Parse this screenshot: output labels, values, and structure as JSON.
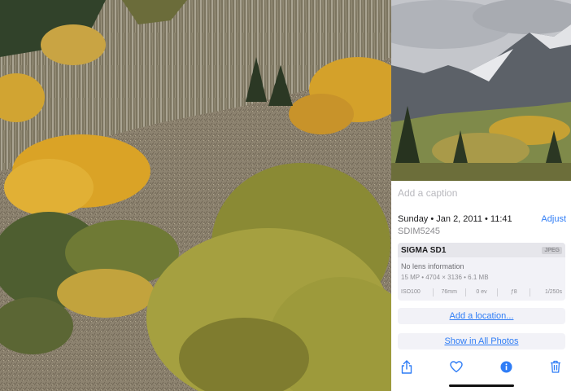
{
  "photo_panel": {
    "caption_placeholder": "Add a caption",
    "date": "Sunday • Jan 2, 2011 • 11:41",
    "adjust_label": "Adjust",
    "filename": "SDIM5245",
    "exif": {
      "camera": "SIGMA SD1",
      "format": "JPEG",
      "lens": "No lens information",
      "specs": "15 MP • 4704 × 3136 • 6.1 MB",
      "iso": "ISO100",
      "focal_length": "76mm",
      "exposure_comp": "0 ev",
      "aperture": "ƒ8",
      "shutter": "1/250s"
    },
    "add_location_label": "Add a location...",
    "show_all_label": "Show in All Photos"
  },
  "toolbar": {
    "icons": [
      "share-icon",
      "heart-icon",
      "info-icon",
      "trash-icon"
    ]
  },
  "colors": {
    "accent": "#2f7df6",
    "sky": "#c9cbd0",
    "aspen_gold": "#d9a21b",
    "hillside": "#8a7f68",
    "pine": "#2f3d22"
  }
}
